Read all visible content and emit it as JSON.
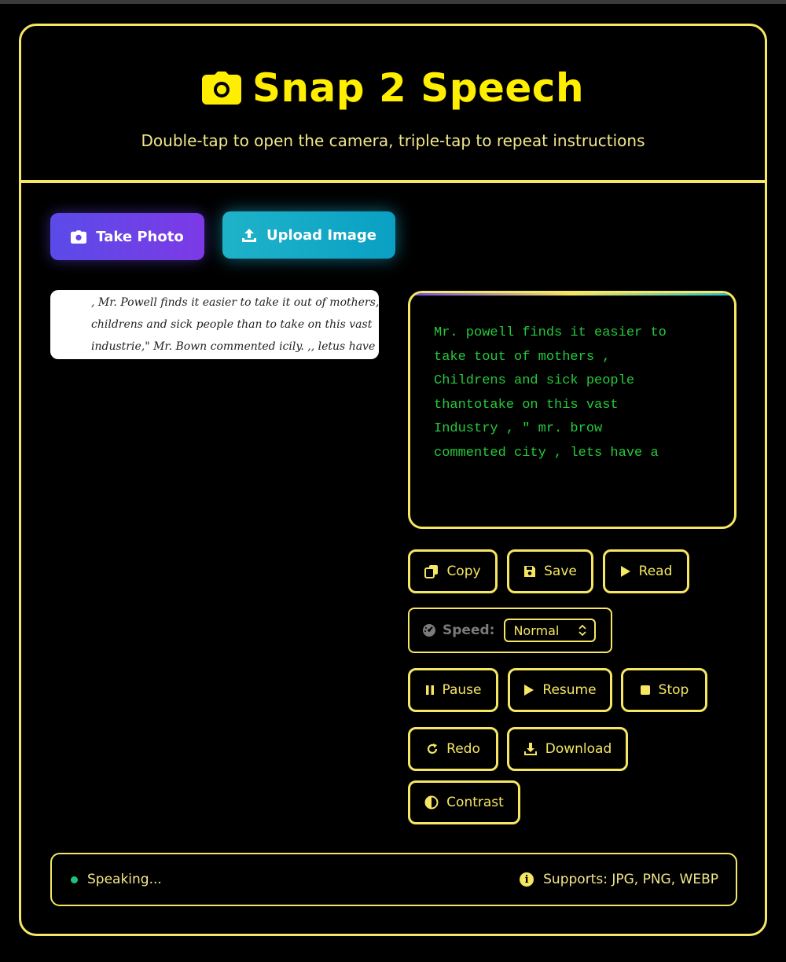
{
  "app": {
    "title": "Snap 2 Speech",
    "subtitle": "Double-tap to open the camera, triple-tap to repeat instructions"
  },
  "actions": {
    "take_photo": "Take Photo",
    "upload_image": "Upload Image"
  },
  "preview": {
    "lines": [
      ", Mr. Powell finds it easier to take it out of mothers,",
      "childrens and sick people than to take on this vast",
      "industrie,\" Mr. Bown commented icily. ,, letus have a"
    ]
  },
  "ocr": {
    "text": "Mr. powell finds it easier to\ntake tout of mothers ,\nChildrens and sick people\nthantotake on this vast\nIndustry , \" mr. brow\ncommented city , lets have a"
  },
  "controls": {
    "copy": "Copy",
    "save": "Save",
    "read": "Read",
    "speed_label": "Speed:",
    "speed_value": "Normal",
    "pause": "Pause",
    "resume": "Resume",
    "stop": "Stop",
    "redo": "Redo",
    "download": "Download",
    "contrast": "Contrast"
  },
  "status": {
    "text": "Speaking...",
    "supports": "Supports: JPG, PNG, WEBP"
  },
  "colors": {
    "accent": "#f5e663",
    "title": "#ffee00",
    "ocr_text": "#25c93b",
    "status_dot": "#1fc07a"
  }
}
